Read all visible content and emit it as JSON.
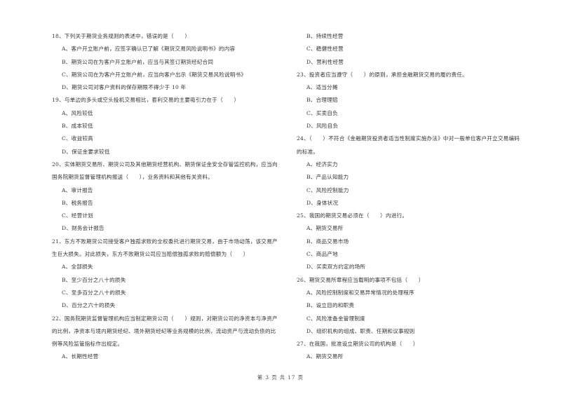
{
  "left_column": {
    "q18": {
      "stem": "18、下列关于期货业务规则的表述中，错误的是（　　）",
      "options": [
        "A、客户开立账户前，应签字确认已了解《期货交易风险说明书》的内容",
        "B、期货公司在为客户开立账户前，应当与其签订期货经纪合同",
        "C、期货公司在为客户开立账户前，应当向客户出示《期货交易风险说明书》",
        "D、期货公司对客户资料的保存期限不得少于 10 年"
      ]
    },
    "q19": {
      "stem": "19、与单边的多头或空头投机交易相比，套利交易的主要吸引力在于（　　）",
      "options": [
        "A、风险较低",
        "B、成本较低",
        "C、收益较高",
        "D、保证金要求较低"
      ]
    },
    "q20": {
      "stem_lines": [
        "20、实体期货交易所、期货公司及其他期货经营机构、期货保证金安全存管监控机构，应当向",
        "国务院期货监督管理机构报送（　　），业务资料和其他有关资料。"
      ],
      "options": [
        "A、审计报告",
        "B、税务报告",
        "C、经营计划",
        "D、财务会计报告"
      ]
    },
    "q21": {
      "stem_lines": [
        "21、东方不败期货公司接受客户独孤求败的全权委托进行期货交易，由于市场动荡，该交易产",
        "生巨大损失。对此损失，东方不败期货公司应当赔偿独孤求败的赔偿额为（　　）"
      ],
      "options": [
        "A、全部损失",
        "B、至少百分之八十的损失",
        "C、至多百分之八十的损失",
        "D、百分之六十的损失"
      ]
    },
    "q22": {
      "stem_lines": [
        "22、国务院期货监督管理机构应当制定期货公司（　　）规则，对期货公司的净资本与净资产",
        "的比例，净资本与境内期货经纪、境外期货经纪等业务规模的比例，流动资产与流动负债的比",
        "例等风险监管指标作出规定。"
      ],
      "options": [
        "A、长期性经营"
      ]
    }
  },
  "right_column": {
    "q22_cont": {
      "options": [
        "B、持续性经营",
        "C、稳健性经营",
        "D、营利性经营"
      ]
    },
    "q23": {
      "stem": "23、投资者应当遵守（　　）的原则，承担金融期货交易的履约责任。",
      "options": [
        "A、适当分摊",
        "B、合理理赔",
        "C、买卖自负",
        "D、风险自负"
      ]
    },
    "q24": {
      "stem_lines": [
        "24、（　　）不符合《金融期货投资者适当性制度实施办法》中对一般单位客户开立交易编码",
        "的标准。"
      ],
      "options": [
        "A、经济实力",
        "B、产品认知能力",
        "C、风险控制能力",
        "D、身体状况"
      ]
    },
    "q25": {
      "stem": "25、我国的期货交易必须在（　　）内进行。",
      "options": [
        "A、期货交易所",
        "B、商品交易市场",
        "C、商品产地",
        "D、买卖双方约定的场所"
      ]
    },
    "q26": {
      "stem": "26、期货交易所章程应当载明的事项不包括（　　）",
      "options": [
        "A、风险控制制度和交易异常情况的处理程序",
        "B、设立目的和职责",
        "C、风险准备金管理制度",
        "D、组织机构的组成、职责、任期和议事规则"
      ]
    },
    "q27": {
      "stem": "27、在我国，批准设立期货公司的机构是（　　）",
      "options": [
        "A、期货交易所"
      ]
    }
  },
  "footer": {
    "page_label": "第 3 页 共 17 页"
  }
}
